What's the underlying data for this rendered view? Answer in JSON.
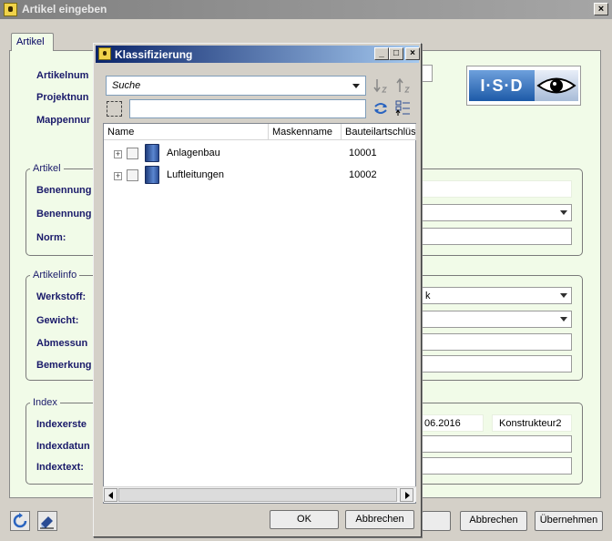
{
  "main_window": {
    "title": "Artikel eingeben",
    "close_glyph": "×",
    "tab": "Artikel",
    "labels": {
      "artikelnummer": "Artikelnum",
      "projektnummer": "Projektnun",
      "mappennummer": "Mappennur"
    },
    "groups": {
      "artikel": {
        "legend": "Artikel",
        "labels": [
          "Benennung",
          "Benennung",
          "Norm:"
        ]
      },
      "artikelinfo": {
        "legend": "Artikelinfo",
        "labels": [
          "Werkstoff:",
          "Gewicht:",
          "Abmessun",
          "Bemerkung"
        ],
        "werkstoff_value": "k"
      },
      "index": {
        "legend": "Index",
        "labels": [
          "Indexerste",
          "Indexdatun",
          "Indextext:"
        ],
        "date_value": "06.2016",
        "user_value": "Konstrukteur2"
      }
    },
    "buttons": {
      "abbrechen": "Abbrechen",
      "uebernehmen": "Übernehmen"
    },
    "logo_text": "I·S·D"
  },
  "dialog": {
    "title": "Klassifizierung",
    "title_buttons": {
      "minimize": "_",
      "maximize": "□",
      "close": "×"
    },
    "search_placeholder": "Suche",
    "columns": [
      "Name",
      "Maskenname",
      "Bauteilartschlüs"
    ],
    "rows": [
      {
        "name": "Anlagenbau",
        "maskenname": "",
        "key": "10001"
      },
      {
        "name": "Luftleitungen",
        "maskenname": "",
        "key": "10002"
      }
    ],
    "buttons": {
      "ok": "OK",
      "abbrechen": "Abbrechen"
    }
  }
}
